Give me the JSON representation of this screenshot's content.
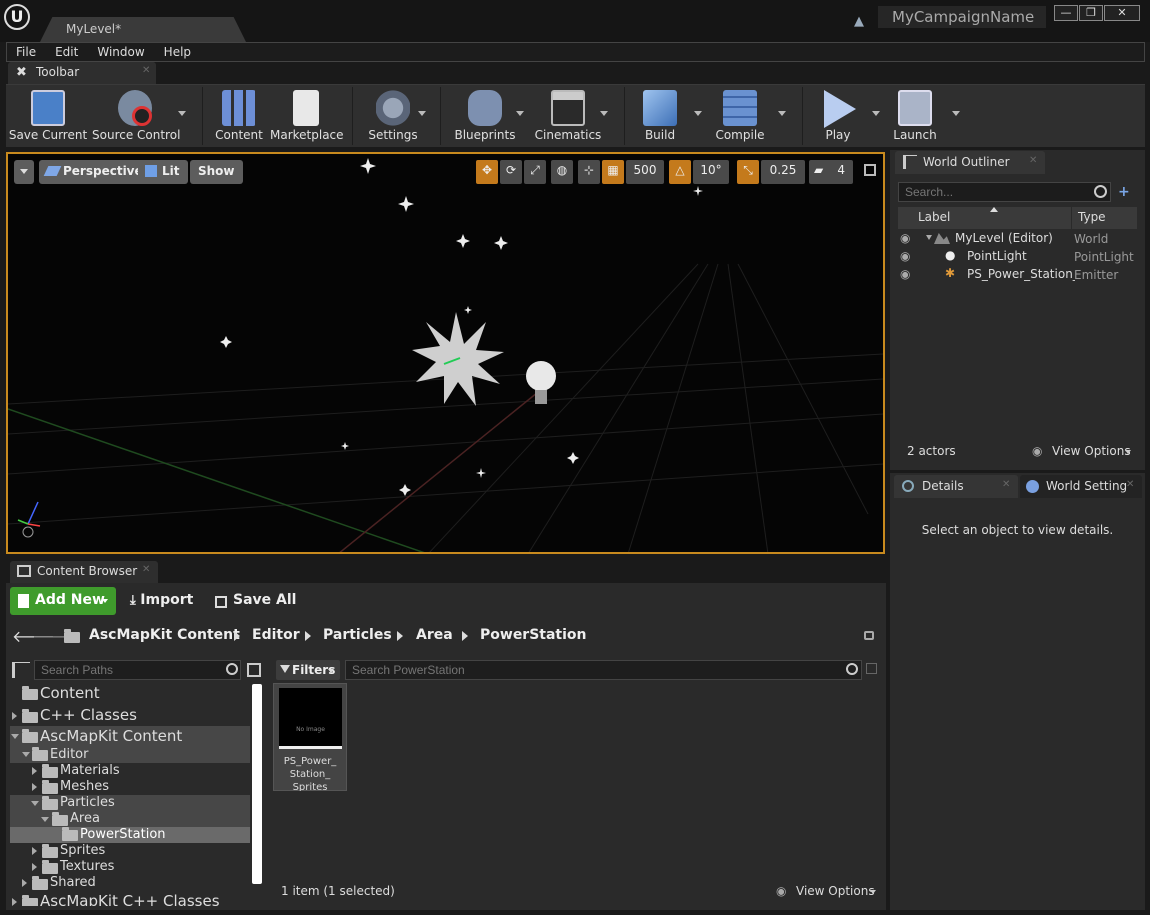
{
  "window": {
    "logo": "U",
    "document_tab": "MyLevel*",
    "campaign_name": "MyCampaignName",
    "controls": {
      "minimize": "—",
      "maximize": "❐",
      "close": "✕"
    }
  },
  "menu": [
    "File",
    "Edit",
    "Window",
    "Help"
  ],
  "toolbar": {
    "tab_label": "Toolbar",
    "buttons": [
      {
        "label": "Save Current",
        "icon": "save-icon"
      },
      {
        "label": "Source Control",
        "icon": "source-control-icon"
      },
      {
        "label": "Content",
        "icon": "content-icon"
      },
      {
        "label": "Marketplace",
        "icon": "marketplace-icon"
      },
      {
        "label": "Settings",
        "icon": "settings-icon"
      },
      {
        "label": "Blueprints",
        "icon": "blueprints-icon"
      },
      {
        "label": "Cinematics",
        "icon": "cinematics-icon"
      },
      {
        "label": "Build",
        "icon": "build-icon"
      },
      {
        "label": "Compile",
        "icon": "compile-icon"
      },
      {
        "label": "Play",
        "icon": "play-icon"
      },
      {
        "label": "Launch",
        "icon": "launch-icon"
      }
    ]
  },
  "viewport": {
    "perspective": "Perspective",
    "lit": "Lit",
    "show": "Show",
    "grid_snap": "500",
    "rotation_snap": "10°",
    "scale_snap": "0.25",
    "camera_speed": "4"
  },
  "outliner": {
    "tab": "World Outliner",
    "search_placeholder": "Search...",
    "col_label": "Label",
    "col_type": "Type",
    "rows": [
      {
        "label": "MyLevel (Editor)",
        "type": "World"
      },
      {
        "label": "PointLight",
        "type": "PointLight"
      },
      {
        "label": "PS_Power_Station_S",
        "type": "Emitter"
      }
    ],
    "actor_count": "2 actors",
    "view_options": "View Options"
  },
  "details": {
    "tab_details": "Details",
    "tab_world": "World Setting",
    "empty_message": "Select an object to view details."
  },
  "content_browser": {
    "tab": "Content Browser",
    "add_new": "Add New",
    "import": "Import",
    "save_all": "Save All",
    "breadcrumb": [
      "AscMapKit Content",
      "Editor",
      "Particles",
      "Area",
      "PowerStation"
    ],
    "path_search_placeholder": "Search Paths",
    "filters": "Filters",
    "asset_search_placeholder": "Search PowerStation",
    "tree": [
      {
        "label": "Content"
      },
      {
        "label": "C++ Classes"
      },
      {
        "label": "AscMapKit Content"
      },
      {
        "label": "Editor"
      },
      {
        "label": "Materials"
      },
      {
        "label": "Meshes"
      },
      {
        "label": "Particles"
      },
      {
        "label": "Area"
      },
      {
        "label": "PowerStation"
      },
      {
        "label": "Sprites"
      },
      {
        "label": "Textures"
      },
      {
        "label": "Shared"
      },
      {
        "label": "AscMapKit C++ Classes"
      }
    ],
    "asset": {
      "name": "PS_Power_ Station_ Sprites",
      "thumb_text": "No Image"
    },
    "status": "1 item (1 selected)",
    "view_options": "View Options"
  }
}
